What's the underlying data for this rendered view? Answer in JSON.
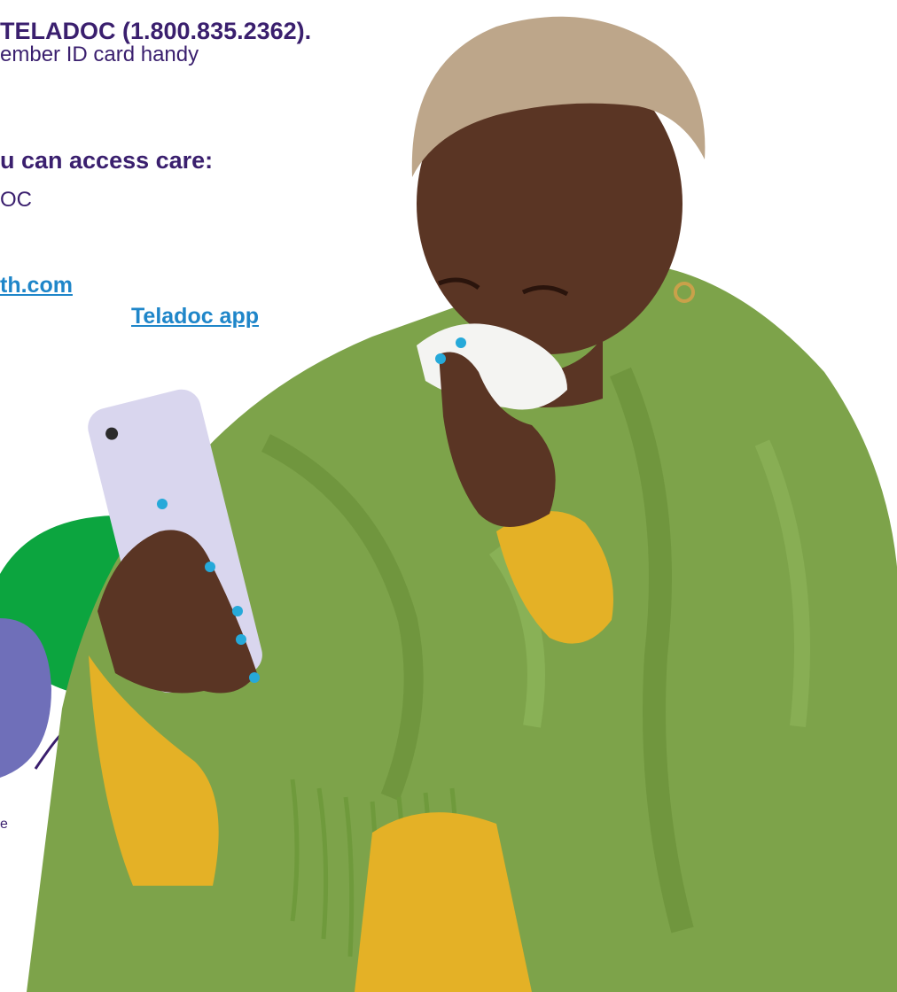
{
  "text": {
    "headline": "TELADOC (1.800.835.2362).",
    "line2": "ember ID card handy",
    "heading2": "u can access care:",
    "line4": "OC",
    "link_web": "th.com",
    "link_app": "Teladoc app",
    "fragment": "e"
  },
  "colors": {
    "brand_purple": "#3a1f6e",
    "link_blue": "#1f86c9",
    "accent_green": "#0ca53f",
    "accent_periwinkle": "#6f6fb9",
    "blanket_green": "#7da34a",
    "sweater_yellow": "#e4b126",
    "skin": "#5a3524",
    "phone": "#d9d6ee",
    "nail_blue": "#26a9d9"
  },
  "photo": {
    "subject": "person-wrapped-in-green-blanket-holding-phone-and-tissue"
  }
}
